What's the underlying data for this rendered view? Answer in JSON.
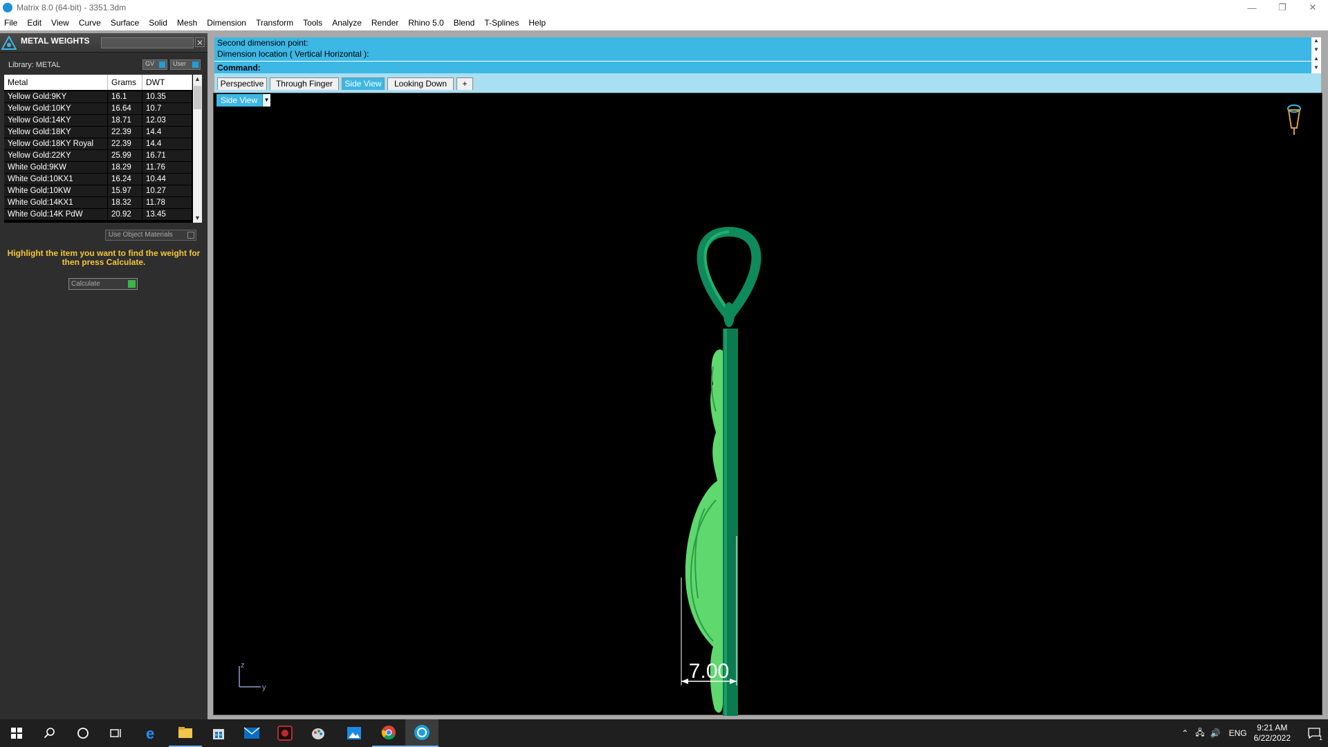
{
  "window": {
    "title": "Matrix 8.0 (64-bit) - 3351.3dm",
    "controls": {
      "minimize": "—",
      "restore": "❐",
      "close": "✕"
    }
  },
  "menu": [
    "File",
    "Edit",
    "View",
    "Curve",
    "Surface",
    "Solid",
    "Mesh",
    "Dimension",
    "Transform",
    "Tools",
    "Analyze",
    "Render",
    "Rhino 5.0",
    "Blend",
    "T-Splines",
    "Help"
  ],
  "panel": {
    "title": "METAL WEIGHTS",
    "library_label": "Library: METAL",
    "gv_label": "GV",
    "user_label": "User",
    "columns": [
      "Metal",
      "Grams",
      "DWT"
    ],
    "rows": [
      [
        "Yellow Gold:9KY",
        "16.1",
        "10.35"
      ],
      [
        "Yellow Gold:10KY",
        "16.64",
        "10.7"
      ],
      [
        "Yellow Gold:14KY",
        "18.71",
        "12.03"
      ],
      [
        "Yellow Gold:18KY",
        "22.39",
        "14.4"
      ],
      [
        "Yellow Gold:18KY Royal",
        "22.39",
        "14.4"
      ],
      [
        "Yellow Gold:22KY",
        "25.99",
        "16.71"
      ],
      [
        "White Gold:9KW",
        "18.29",
        "11.76"
      ],
      [
        "White Gold:10KX1",
        "16.24",
        "10.44"
      ],
      [
        "White Gold:10KW",
        "15.97",
        "10.27"
      ],
      [
        "White Gold:14KX1",
        "18.32",
        "11.78"
      ],
      [
        "White Gold:14K PdW",
        "20.92",
        "13.45"
      ]
    ],
    "use_object_materials": "Use Object Materials",
    "hint": "Highlight the item you want to find the weight for then press Calculate.",
    "calculate": "Calculate"
  },
  "command": {
    "line1": "Second dimension point:",
    "line2": "Dimension location ( Vertical  Horizontal ):",
    "prompt": "Command:",
    "value": ""
  },
  "tabs": [
    "Perspective",
    "Through Finger",
    "Side View",
    "Looking Down"
  ],
  "active_tab": "Side View",
  "add_tab_icon": "+",
  "viewport": {
    "label": "Side View",
    "dimension": "7.00",
    "axis_z": "z",
    "axis_y": "y"
  },
  "taskbar": {
    "icons": [
      "start-icon",
      "search-icon",
      "cortana-icon",
      "task-view-icon",
      "edge-icon",
      "file-explorer-icon",
      "store-icon",
      "mail-icon",
      "app-red-icon",
      "paint-icon",
      "photos-icon",
      "chrome-icon",
      "matrix-icon"
    ],
    "time": "9:21 AM",
    "date": "6/22/2022",
    "lang": "ENG",
    "notif_count": "1"
  },
  "colors": {
    "accent": "#3db7e4",
    "model_dark": "#0f8a5a",
    "model_light": "#6fe07a",
    "hint_text": "#f4c63a"
  }
}
